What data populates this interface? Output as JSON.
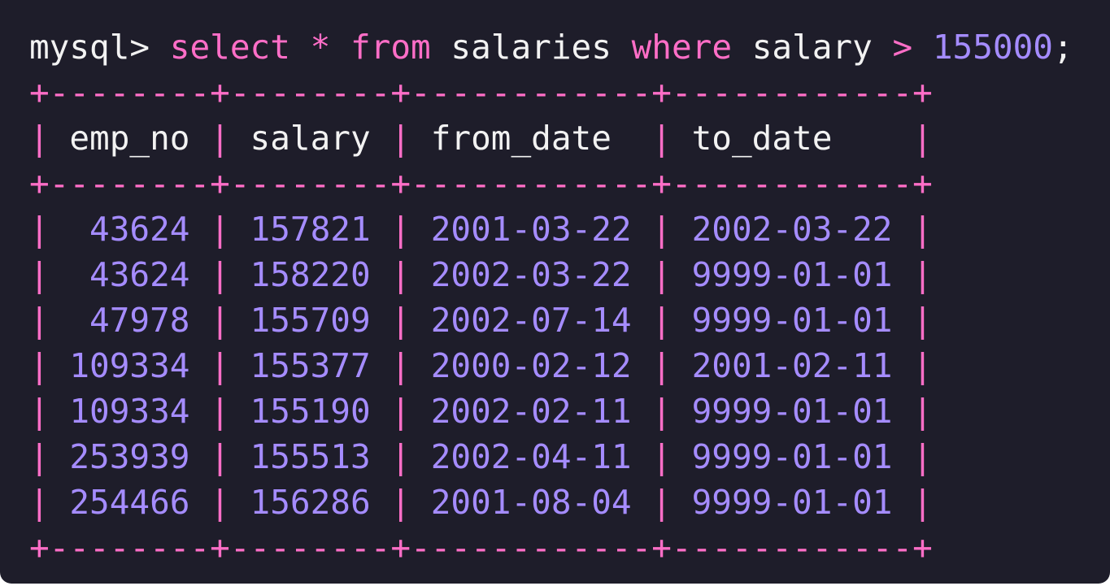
{
  "terminal": {
    "prompt": "mysql>",
    "query": {
      "select_kw": "select",
      "star": "*",
      "from_kw": "from",
      "table_name": "salaries",
      "where_kw": "where",
      "column": "salary",
      "operator": ">",
      "value": "155000",
      "terminator": ";"
    },
    "colors": {
      "background": "#1e1d2a",
      "keyword": "#ff6ec7",
      "number": "#a58cff",
      "text": "#f2f2f2"
    }
  },
  "result": {
    "separator": "+--------+--------+------------+------------+",
    "columns": [
      "emp_no",
      "salary",
      "from_date",
      "to_date"
    ],
    "rows": [
      [
        "43624",
        "157821",
        "2001-03-22",
        "2002-03-22"
      ],
      [
        "43624",
        "158220",
        "2002-03-22",
        "9999-01-01"
      ],
      [
        "47978",
        "155709",
        "2002-07-14",
        "9999-01-01"
      ],
      [
        "109334",
        "155377",
        "2000-02-12",
        "2001-02-11"
      ],
      [
        "109334",
        "155190",
        "2002-02-11",
        "9999-01-01"
      ],
      [
        "253939",
        "155513",
        "2002-04-11",
        "9999-01-01"
      ],
      [
        "254466",
        "156286",
        "2001-08-04",
        "9999-01-01"
      ]
    ]
  }
}
